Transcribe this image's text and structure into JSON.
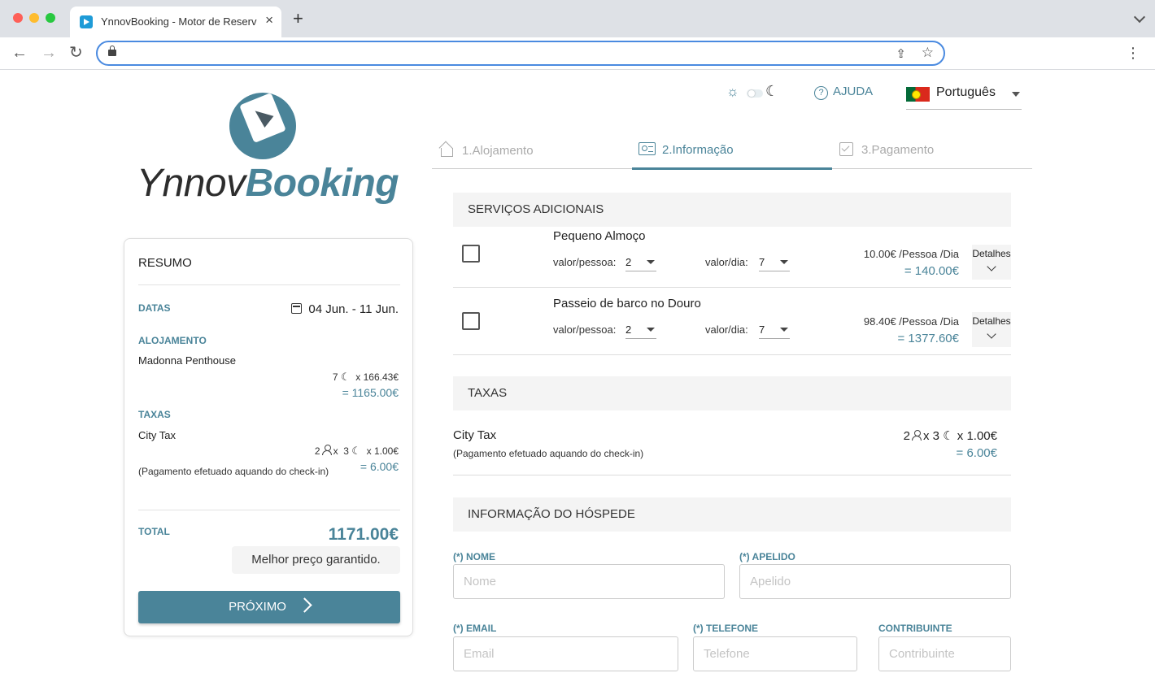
{
  "browser": {
    "tab_title": "YnnovBooking - Motor de Reservas",
    "tab_close": "×",
    "new_tab": "+",
    "back": "←",
    "forward": "→",
    "reload": "↻",
    "share": "⇪",
    "star": "☆",
    "menu": "⋮"
  },
  "logo": {
    "part1": "Ynnov",
    "part2": "Booking"
  },
  "topbar": {
    "help_icon": "?",
    "help_label": "AJUDA",
    "language": "Português",
    "sun": "☼",
    "moon": "☾"
  },
  "steps": [
    {
      "label": "1.Alojamento"
    },
    {
      "label": "2.Informação"
    },
    {
      "label": "3.Pagamento"
    }
  ],
  "summary": {
    "title": "RESUMO",
    "dates_label": "DATAS",
    "dates_value": "04 Jun. - 11 Jun.",
    "accommodation_label": "ALOJAMENTO",
    "accommodation_name": "Madonna Penthouse",
    "nights": "7",
    "nightly_rate": "x 166.43€",
    "accommodation_total": "= 1165.00€",
    "taxes_label": "TAXAS",
    "tax_name": "City Tax",
    "tax_persons": "2",
    "tax_x": "x",
    "tax_nights": "3",
    "tax_rate": "x 1.00€",
    "tax_note": "(Pagamento efetuado aquando do check-in)",
    "tax_total": "= 6.00€",
    "total_label": "TOTAL",
    "total_value": "1171.00€",
    "guarantee": "Melhor preço garantido.",
    "next_button": "PRÓXIMO"
  },
  "services": {
    "title": "SERVIÇOS ADICIONAIS",
    "items": [
      {
        "name": "Pequeno Almoço",
        "person_label": "valor/pessoa:",
        "person_value": "2",
        "day_label": "valor/dia:",
        "day_value": "7",
        "unit_price": "10.00€ /Pessoa /Dia",
        "total": "= 140.00€",
        "details": "Detalhes"
      },
      {
        "name": "Passeio de barco no Douro",
        "person_label": "valor/pessoa:",
        "person_value": "2",
        "day_label": "valor/dia:",
        "day_value": "7",
        "unit_price": "98.40€ /Pessoa /Dia",
        "total": "= 1377.60€",
        "details": "Detalhes"
      }
    ]
  },
  "taxes": {
    "title": "TAXAS",
    "name": "City Tax",
    "note": "(Pagamento efetuado aquando do check-in)",
    "persons": "2",
    "x": "x",
    "nights": "3",
    "rate": "x 1.00€",
    "total": "= 6.00€"
  },
  "guest": {
    "title": "INFORMAÇÃO DO HÓSPEDE",
    "first_name_label": "(*) NOME",
    "first_name_placeholder": "Nome",
    "last_name_label": "(*) APELIDO",
    "last_name_placeholder": "Apelido",
    "email_label": "(*) EMAIL",
    "email_placeholder": "Email",
    "phone_label": "(*) TELEFONE",
    "phone_placeholder": "Telefone",
    "taxid_label": "CONTRIBUINTE",
    "taxid_placeholder": "Contribuinte"
  },
  "colors": {
    "accent": "#4a8499",
    "chrome": "#dee1e6"
  }
}
